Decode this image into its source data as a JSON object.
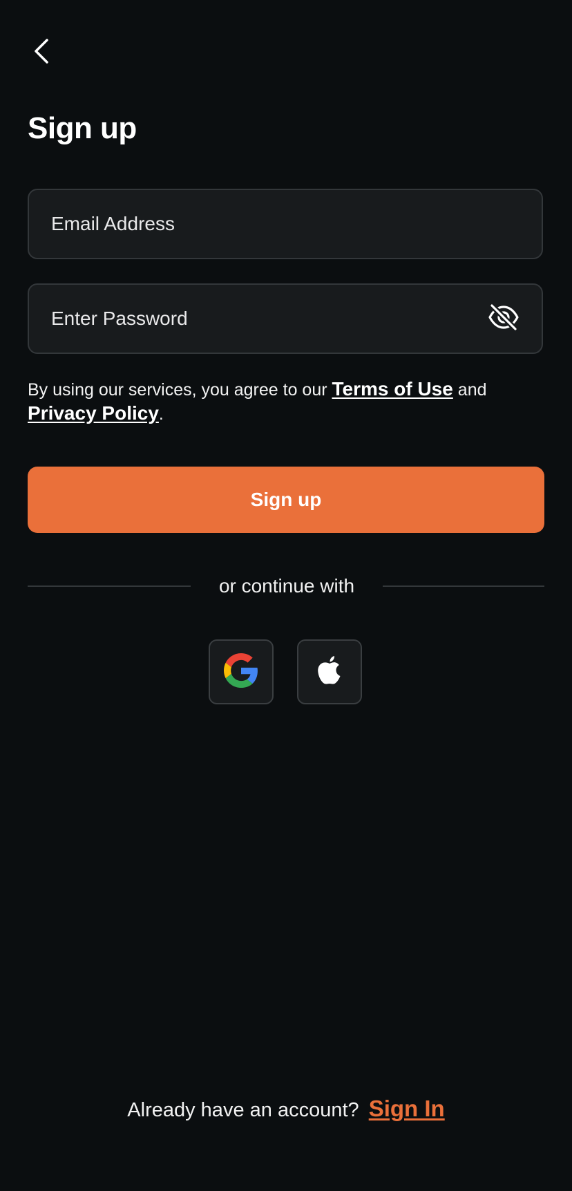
{
  "header": {
    "back_icon": "chevron-left-icon",
    "title": "Sign up"
  },
  "form": {
    "email": {
      "placeholder": "Email Address",
      "value": ""
    },
    "password": {
      "placeholder": "Enter Password",
      "value": "",
      "toggle_icon": "eye-off-icon"
    }
  },
  "terms": {
    "prefix": "By using our services, you agree to our ",
    "terms_link": "Terms of Use",
    "middle": " and",
    "privacy_link": "Privacy Policy",
    "suffix": "."
  },
  "primary_button": {
    "label": "Sign up"
  },
  "divider": {
    "label": "or continue with"
  },
  "social": [
    {
      "name": "Google",
      "icon": "google-icon"
    },
    {
      "name": "Apple",
      "icon": "apple-icon"
    }
  ],
  "footer": {
    "prompt": "Already have an account?",
    "link": "Sign In"
  },
  "colors": {
    "background": "#0b0e10",
    "field_background": "#181b1d",
    "border": "#33373a",
    "accent": "#ea703a",
    "text": "#ffffff"
  }
}
